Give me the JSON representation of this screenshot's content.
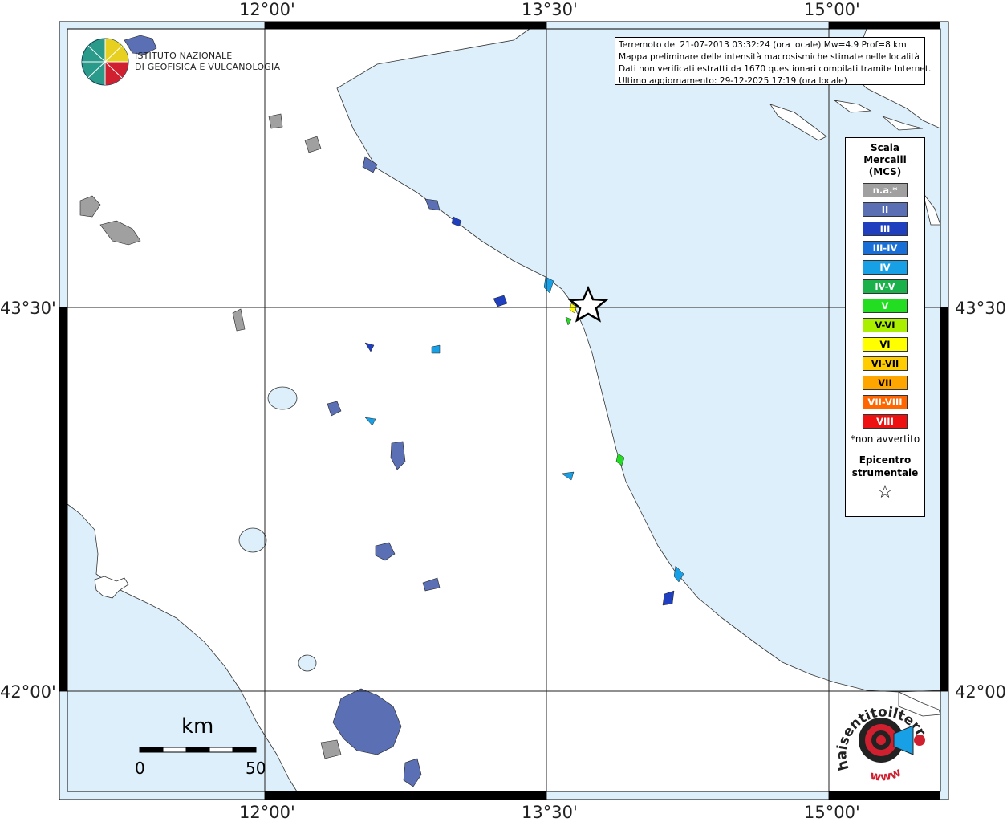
{
  "map": {
    "longitude_labels": [
      "12°00'",
      "13°30'",
      "15°00'"
    ],
    "latitude_labels": [
      "43°30'",
      "42°00'"
    ]
  },
  "logo": {
    "name": "ingv-logo-icon",
    "line1": "ISTITUTO NAZIONALE",
    "line2": "DI GEOFISICA E VULCANOLOGIA"
  },
  "info": {
    "line1": "Terremoto del 21-07-2013 03:32:24 (ora locale) Mw=4.9 Prof=8 km",
    "line2": "Mappa preliminare delle intensità macrosismiche stimate nelle località",
    "line3": "Dati non verificati estratti da 1670 questionari compilati tramite Internet.",
    "line4": "Ultimo aggiornamento: 29-12-2025 17:19 (ora locale)"
  },
  "legend": {
    "title1": "Scala",
    "title2": "Mercalli",
    "title3": "(MCS)",
    "items": [
      {
        "label": "n.a.*",
        "color": "#a0a0a0"
      },
      {
        "label": "II",
        "color": "#5a6fb4"
      },
      {
        "label": "III",
        "color": "#1f3fbf"
      },
      {
        "label": "III-IV",
        "color": "#1a6fd6"
      },
      {
        "label": "IV",
        "color": "#18a0e6"
      },
      {
        "label": "IV-V",
        "color": "#1ab04a"
      },
      {
        "label": "V",
        "color": "#22dd22"
      },
      {
        "label": "V-VI",
        "color": "#aaee00"
      },
      {
        "label": "VI",
        "color": "#ffff00"
      },
      {
        "label": "VI-VII",
        "color": "#ffcc00"
      },
      {
        "label": "VII",
        "color": "#ffa500"
      },
      {
        "label": "VII-VIII",
        "color": "#ff6600"
      },
      {
        "label": "VIII",
        "color": "#ee1111"
      }
    ],
    "note": "*non avvertito",
    "epicenter1": "Epicentro",
    "epicenter2": "strumentale",
    "epicenter_icon": "star-icon"
  },
  "scale_bar": {
    "unit": "km",
    "start": "0",
    "end": "50"
  },
  "watermark": {
    "text": "haisentitoilterremoto.it",
    "url": "www",
    "icon": "megaphone-logo-icon"
  },
  "colors": {
    "sea": "#ddeffa",
    "land": "#ffffff",
    "epicenter": "#000000"
  }
}
